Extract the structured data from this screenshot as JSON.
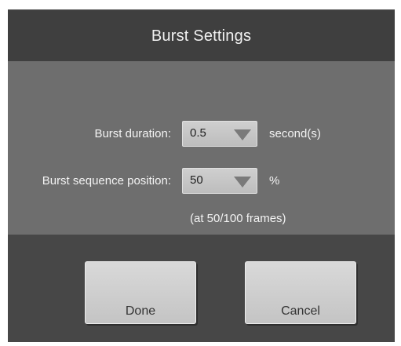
{
  "dialog": {
    "title": "Burst Settings"
  },
  "settings": {
    "duration": {
      "label": "Burst duration:",
      "value": "0.5",
      "unit": "second(s)"
    },
    "position": {
      "label": "Burst sequence position:",
      "value": "50",
      "unit": "%",
      "note": "(at 50/100 frames)"
    }
  },
  "buttons": {
    "done_label": "Done",
    "cancel_label": "Cancel"
  },
  "colors": {
    "dialog_background": "#474747",
    "title_bar": "#3f3f3f",
    "settings_panel": "#6e6e6e",
    "control_gray": "#c9c9c9"
  }
}
